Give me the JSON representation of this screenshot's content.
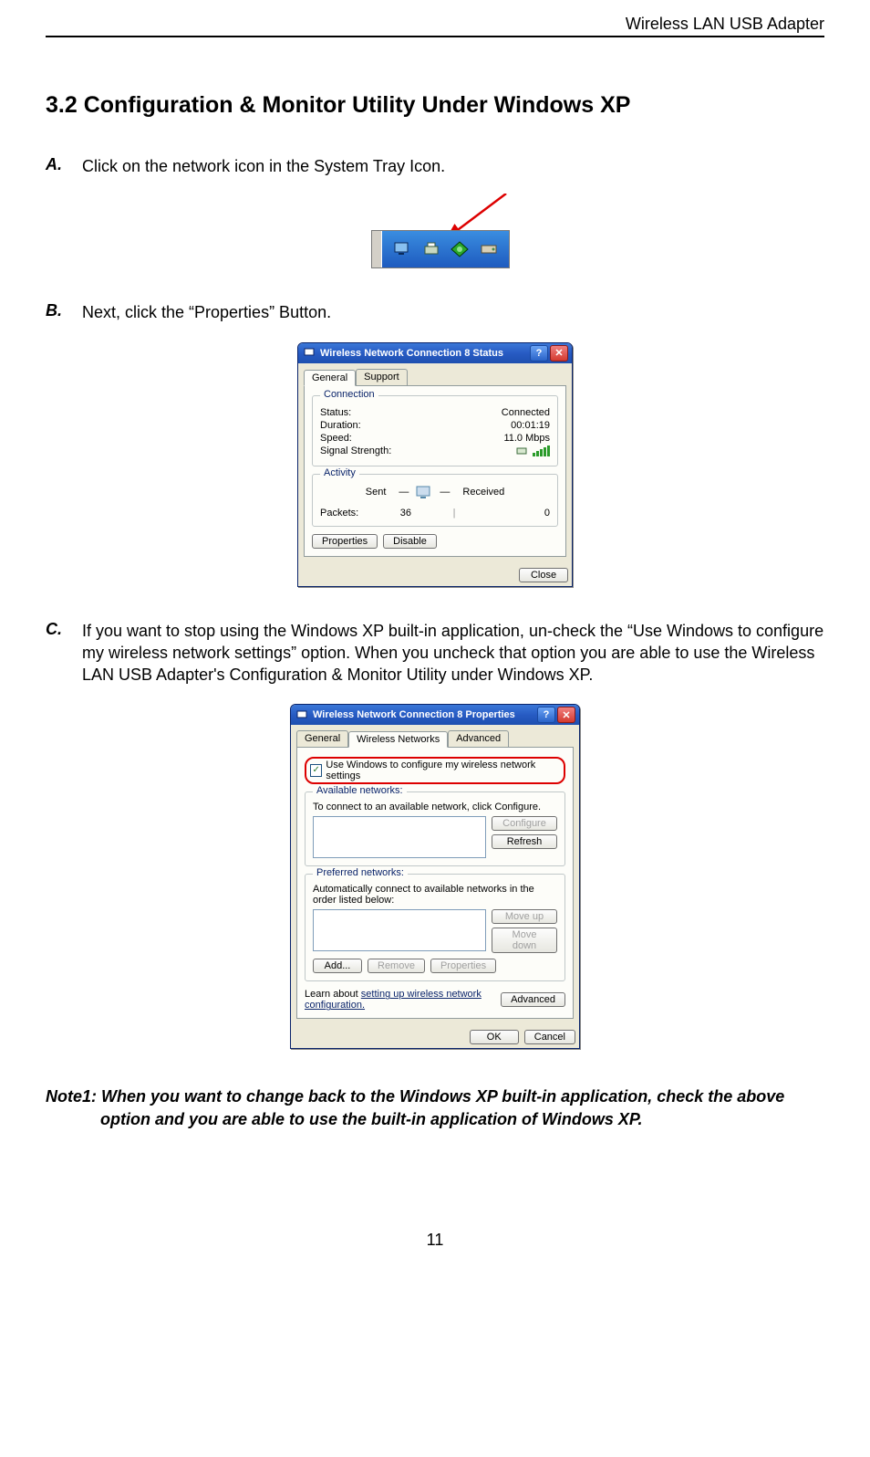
{
  "page": {
    "header_right": "Wireless LAN USB Adapter",
    "section_title": "3.2 Configuration & Monitor Utility Under Windows XP",
    "page_number": "11"
  },
  "steps": {
    "a": {
      "marker": "A.",
      "text": "Click on the network icon in the System Tray Icon."
    },
    "b": {
      "marker": "B.",
      "text": "Next, click the “Properties” Button."
    },
    "c": {
      "marker": "C.",
      "text": "If you want to stop using the Windows XP built-in application, un-check the “Use Windows to configure my wireless network settings” option. When you uncheck that option you are able to use the Wireless LAN USB Adapter's Configuration & Monitor Utility under Windows XP."
    }
  },
  "note1": {
    "text": "Note1: When you want to change back to the Windows XP built-in application, check the above option and you are able to use the built-in application of Windows XP."
  },
  "status_window": {
    "title": "Wireless Network Connection 8 Status",
    "tabs": {
      "general": "General",
      "support": "Support"
    },
    "connection_group": "Connection",
    "rows": {
      "status_label": "Status:",
      "status_value": "Connected",
      "duration_label": "Duration:",
      "duration_value": "00:01:19",
      "speed_label": "Speed:",
      "speed_value": "11.0 Mbps",
      "signal_label": "Signal Strength:"
    },
    "activity_group": "Activity",
    "activity": {
      "sent_label": "Sent",
      "received_label": "Received",
      "packets_label": "Packets:",
      "sent_value": "36",
      "received_value": "0"
    },
    "buttons": {
      "properties": "Properties",
      "disable": "Disable",
      "close": "Close"
    }
  },
  "props_window": {
    "title": "Wireless Network Connection 8 Properties",
    "tabs": {
      "general": "General",
      "wireless": "Wireless Networks",
      "advanced": "Advanced"
    },
    "use_windows_label": "Use Windows to configure my wireless network settings",
    "available_group": "Available networks:",
    "available_hint": "To connect to an available network, click Configure.",
    "preferred_group": "Preferred networks:",
    "preferred_hint": "Automatically connect to available networks in the order listed below:",
    "buttons": {
      "configure": "Configure",
      "refresh": "Refresh",
      "moveup": "Move up",
      "movedown": "Move down",
      "add": "Add...",
      "remove": "Remove",
      "properties": "Properties",
      "advanced": "Advanced",
      "ok": "OK",
      "cancel": "Cancel"
    },
    "learn_prefix": "Learn about ",
    "learn_link": "setting up wireless network configuration."
  }
}
